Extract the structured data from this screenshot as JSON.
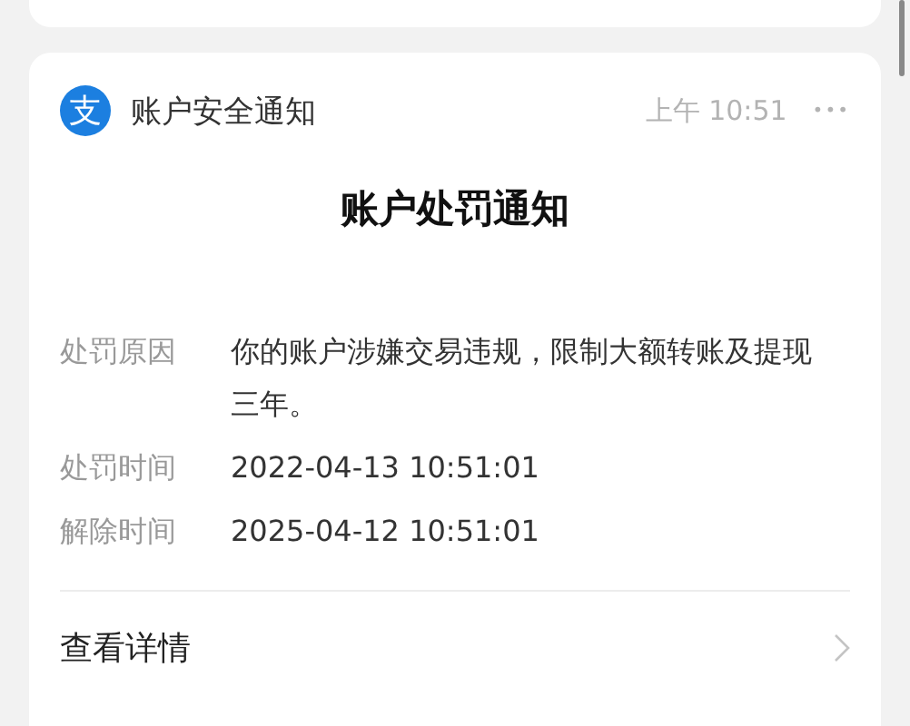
{
  "notification": {
    "app_icon_glyph": "支",
    "sender": "账户安全通知",
    "time": "上午 10:51",
    "more": "•••",
    "title": "账户处罚通知",
    "fields": [
      {
        "label": "处罚原因",
        "value": "你的账户涉嫌交易违规，限制大额转账及提现三年。"
      },
      {
        "label": "处罚时间",
        "value": "2022-04-13 10:51:01"
      },
      {
        "label": "解除时间",
        "value": "2025-04-12 10:51:01"
      }
    ],
    "action": "查看详情"
  }
}
